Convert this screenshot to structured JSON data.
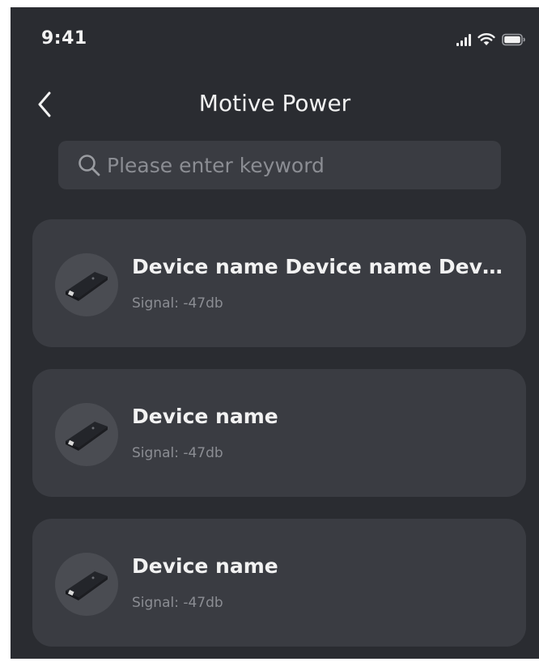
{
  "status_bar": {
    "time": "9:41"
  },
  "header": {
    "title": "Motive Power"
  },
  "search": {
    "placeholder": "Please enter keyword",
    "value": ""
  },
  "devices": [
    {
      "name": "Device name Device name Device name",
      "signal": "Signal: -47db"
    },
    {
      "name": "Device name",
      "signal": "Signal: -47db"
    },
    {
      "name": "Device name",
      "signal": "Signal: -47db"
    }
  ],
  "colors": {
    "background": "#2a2c31",
    "card": "#3a3c42",
    "text_primary": "#f2f2f2",
    "text_secondary": "#8b8d93"
  },
  "icons": {
    "back": "chevron-left-icon",
    "search": "search-icon",
    "signal": "cellular-signal-icon",
    "wifi": "wifi-icon",
    "battery": "battery-icon",
    "device": "device-dongle-icon"
  }
}
